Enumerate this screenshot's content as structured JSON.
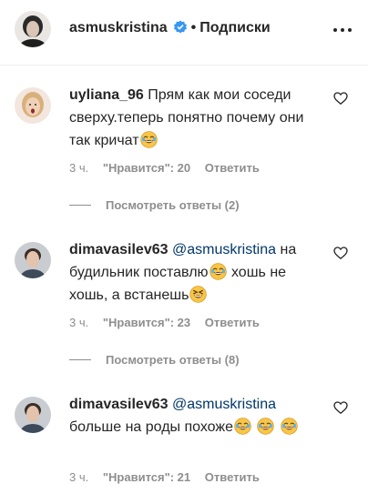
{
  "header": {
    "username": "asmuskristina",
    "separator": "•",
    "follow_label": "Подписки"
  },
  "comments": [
    {
      "username": "uyliana_96",
      "text": "Прям как мои соседи сверху.теперь понятно почему они так кричат",
      "emoji": "joy-emoji",
      "time": "3 ч.",
      "likes": "\"Нравится\": 20",
      "reply": "Ответить",
      "view_replies": "Посмотреть ответы (2)"
    },
    {
      "username": "dimavasilev63",
      "mention": "@asmuskristina",
      "text_part1": "на будильник поставлю",
      "text_part2": "хошь не хошь, а встанешь",
      "time": "3 ч.",
      "likes": "\"Нравится\": 23",
      "reply": "Ответить",
      "view_replies": "Посмотреть ответы (8)"
    },
    {
      "username": "dimavasilev63",
      "mention": "@asmuskristina",
      "text": "больше на роды похоже",
      "time": "3 ч.",
      "likes": "\"Нравится\": 21",
      "reply": "Ответить"
    }
  ],
  "colors": {
    "text": "#262626",
    "meta": "#8e8e8e",
    "mention": "#00376b",
    "verified": "#3897f0"
  }
}
